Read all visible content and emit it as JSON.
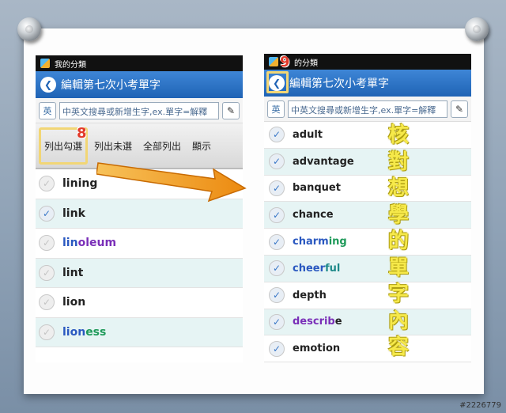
{
  "left_screen": {
    "status_title": "我的分類",
    "title": "編輯第七次小考單字",
    "search_placeholder": "中英文搜尋或新增生字,ex.單字=解釋",
    "search_button": "英",
    "filters": [
      {
        "label": "列出勾選",
        "active": true
      },
      {
        "label": "列出未選",
        "active": false
      },
      {
        "label": "全部列出",
        "active": false
      },
      {
        "label": "顯示",
        "active": false
      }
    ],
    "words": [
      {
        "prefix": "lining",
        "suffix": "",
        "checked": false,
        "color": "plain"
      },
      {
        "prefix": "link",
        "suffix": "",
        "checked": true,
        "color": "plain"
      },
      {
        "prefix": "lin",
        "suffix": "oleum",
        "checked": false,
        "color": "purple"
      },
      {
        "prefix": "lint",
        "suffix": "",
        "checked": false,
        "color": "plain"
      },
      {
        "prefix": "lion",
        "suffix": "",
        "checked": false,
        "color": "plain"
      },
      {
        "prefix": "lion",
        "suffix": "ess",
        "checked": false,
        "color": "blue"
      }
    ]
  },
  "right_screen": {
    "status_title": "的分類",
    "title": "編輯第七次小考單字",
    "search_placeholder": "中英文搜尋或新增生字,ex.單字=解釋",
    "search_button": "英",
    "words": [
      {
        "prefix": "adult",
        "suffix": "",
        "color": "plain"
      },
      {
        "prefix": "advantage",
        "suffix": "",
        "color": "plain"
      },
      {
        "prefix": "banquet",
        "suffix": "",
        "color": "plain"
      },
      {
        "prefix": "chance",
        "suffix": "",
        "color": "plain"
      },
      {
        "prefix": "charm",
        "suffix": "ing",
        "color": "blue-green"
      },
      {
        "prefix": "cheer",
        "suffix": "ful",
        "color": "blue-teal"
      },
      {
        "prefix": "depth",
        "suffix": "",
        "color": "plain"
      },
      {
        "prefix": "describ",
        "suffix": "e",
        "color": "purple-plain"
      },
      {
        "prefix": "emotion",
        "suffix": "",
        "color": "plain"
      }
    ]
  },
  "callouts": {
    "step8": "8",
    "step9": "9"
  },
  "annotation_chars": [
    "核",
    "對",
    "想",
    "學",
    "的",
    "單",
    "字",
    "內",
    "容"
  ],
  "watermark": "#2226779",
  "colors": {
    "titlebar": "#1f63b5",
    "highlight": "#f2d675",
    "annotation": "#f6e94a",
    "arrow": "#f0a020"
  }
}
